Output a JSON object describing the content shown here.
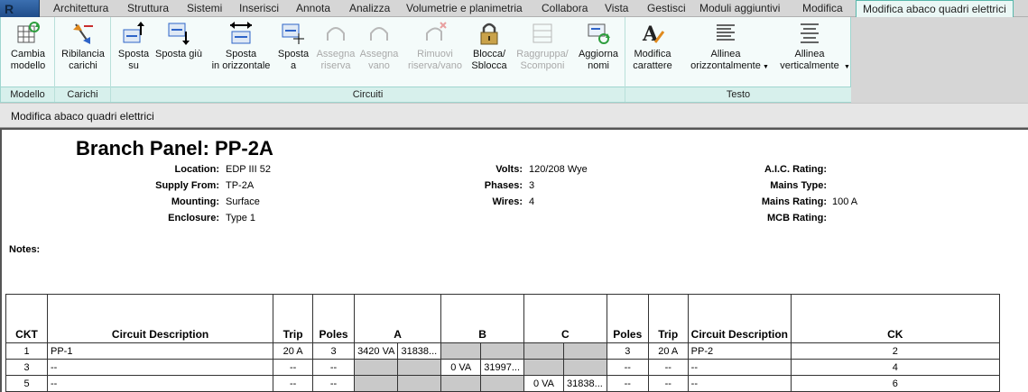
{
  "tabs": [
    {
      "label": "Architettura",
      "active": false
    },
    {
      "label": "Struttura",
      "active": false
    },
    {
      "label": "Sistemi",
      "active": false
    },
    {
      "label": "Inserisci",
      "active": false
    },
    {
      "label": "Annota",
      "active": false
    },
    {
      "label": "Analizza",
      "active": false
    },
    {
      "label": "Volumetrie e planimetria",
      "active": false
    },
    {
      "label": "Collabora",
      "active": false
    },
    {
      "label": "Vista",
      "active": false
    },
    {
      "label": "Gestisci",
      "active": false
    },
    {
      "label": "Moduli aggiuntivi",
      "active": false
    },
    {
      "label": "Modifica",
      "active": false
    },
    {
      "label": "Modifica abaco quadri elettrici",
      "active": true
    }
  ],
  "app_button": {
    "glyph": "R"
  },
  "ribbon": {
    "panels": {
      "modello": "Modello",
      "carichi": "Carichi",
      "circuiti": "Circuiti",
      "testo": "Testo"
    },
    "buttons": {
      "cambia_modello": "Cambia\nmodello",
      "ribilancia_carichi": "Ribilancia\ncarichi",
      "sposta_su": "Sposta\nsu",
      "sposta_giu": "Sposta giù",
      "sposta_orizzontale": "Sposta\nin orizzontale",
      "sposta_a": "Sposta\na",
      "assegna_riserva": "Assegna\nriserva",
      "assegna_vano": "Assegna\nvano",
      "rimuovi_riserva_vano": "Rimuovi\nriserva/vano",
      "blocca_sblocca": "Blocca/\nSblocca",
      "raggruppa_scomponi": "Raggruppa/\nScomponi",
      "aggiorna_nomi": "Aggiorna\nnomi",
      "modifica_carattere": "Modifica\ncarattere",
      "allinea_orizzontalmente": "Allinea\norizzontalmente",
      "allinea_verticalmente": "Allinea\nverticalmente"
    },
    "icons": {
      "cambia_modello": "table-swap-icon",
      "ribilancia_carichi": "rebalance-icon",
      "sposta_su": "move-up-icon",
      "sposta_giu": "move-down-icon",
      "sposta_orizzontale": "move-horizontal-icon",
      "sposta_a": "move-to-icon",
      "assegna_riserva": "assign-spare-icon",
      "assegna_vano": "assign-space-icon",
      "rimuovi_riserva_vano": "remove-spare-icon",
      "blocca_sblocca": "lock-icon",
      "raggruppa_scomponi": "group-icon",
      "aggiorna_nomi": "refresh-names-icon",
      "modifica_carattere": "font-icon",
      "allinea_orizzontalmente": "align-horizontal-icon",
      "allinea_verticalmente": "align-vertical-icon"
    }
  },
  "options_bar": {
    "label": "Modifica abaco quadri elettrici"
  },
  "schedule": {
    "title": "Branch Panel: PP-2A",
    "header": {
      "location_label": "Location:",
      "location_value": "EDP III 52",
      "supply_label": "Supply From:",
      "supply_value": "TP-2A",
      "mounting_label": "Mounting:",
      "mounting_value": "Surface",
      "enclosure_label": "Enclosure:",
      "enclosure_value": "Type 1",
      "volts_label": "Volts:",
      "volts_value": "120/208 Wye",
      "phases_label": "Phases:",
      "phases_value": "3",
      "wires_label": "Wires:",
      "wires_value": "4",
      "aic_label": "A.I.C. Rating:",
      "mains_type_label": "Mains Type:",
      "mains_rating_label": "Mains Rating:",
      "mains_rating_value": "100 A",
      "mcb_label": "MCB Rating:"
    },
    "notes_label": "Notes:",
    "columns": {
      "ckt_left": "CKT",
      "desc_left": "Circuit Description",
      "trip_left": "Trip",
      "poles_left": "Poles",
      "phase_a": "A",
      "phase_b": "B",
      "phase_c": "C",
      "poles_right": "Poles",
      "trip_right": "Trip",
      "desc_right": "Circuit Description",
      "ckt_right": "CK"
    },
    "rows": [
      {
        "ckt_l": "1",
        "desc_l": "PP-1",
        "trip_l": "20 A",
        "poles_l": "3",
        "a1": "3420 VA",
        "a2": "31838...",
        "b1": "",
        "b2": "",
        "c1": "",
        "c2": "",
        "poles_r": "3",
        "trip_r": "20 A",
        "desc_r": "PP-2",
        "ckt_r": "2"
      },
      {
        "ckt_l": "3",
        "desc_l": "--",
        "trip_l": "--",
        "poles_l": "--",
        "a1": "",
        "a2": "",
        "b1": "0 VA",
        "b2": "31997...",
        "c1": "",
        "c2": "",
        "poles_r": "--",
        "trip_r": "--",
        "desc_r": "--",
        "ckt_r": "4"
      },
      {
        "ckt_l": "5",
        "desc_l": "--",
        "trip_l": "--",
        "poles_l": "--",
        "a1": "",
        "a2": "",
        "b1": "",
        "b2": "",
        "c1": "0 VA",
        "c2": "31838...",
        "poles_r": "--",
        "trip_r": "--",
        "desc_r": "--",
        "ckt_r": "6"
      }
    ]
  }
}
